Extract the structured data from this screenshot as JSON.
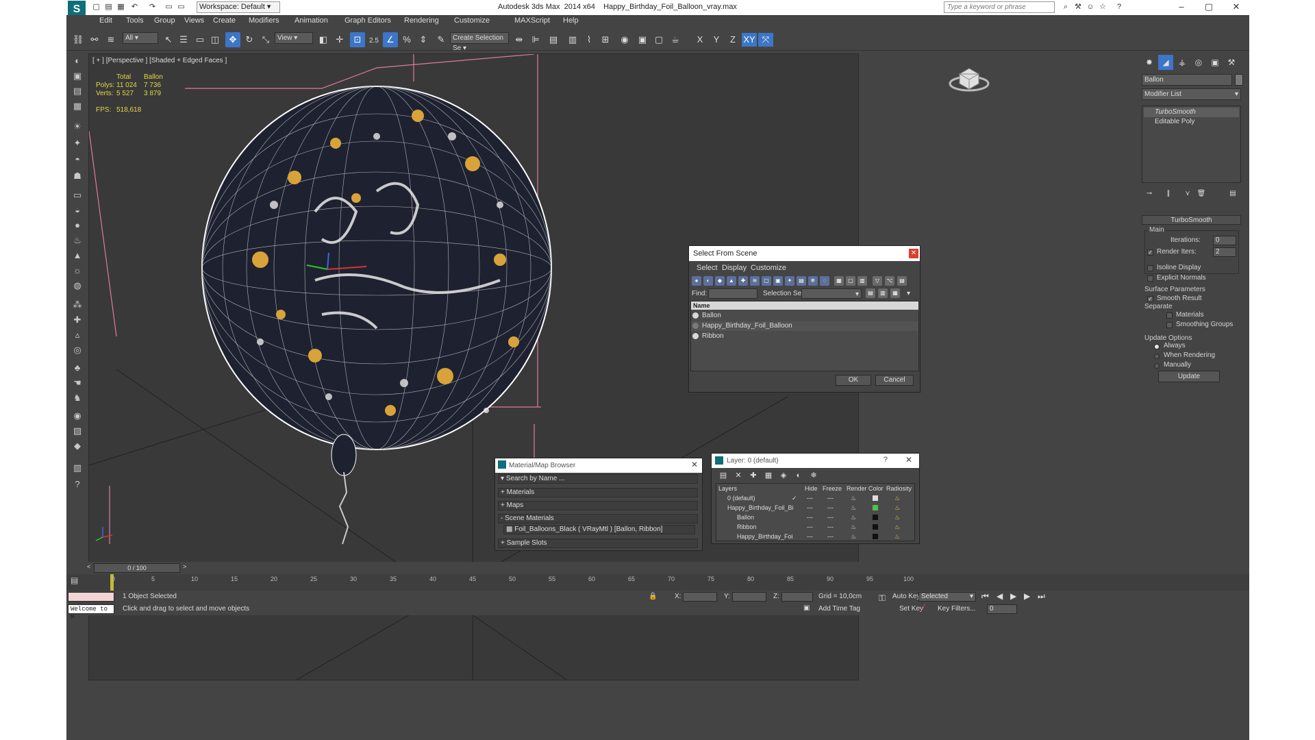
{
  "app": {
    "title": "Autodesk 3ds Max  2014 x64    Happy_Birthday_Foil_Balloon_vray.max",
    "workspace": "Workspace: Default",
    "search_placeholder": "Type a keyword or phrase"
  },
  "menu": [
    "Edit",
    "Tools",
    "Group",
    "Views",
    "Create",
    "Modifiers",
    "Animation",
    "Graph Editors",
    "Rendering",
    "Customize",
    "MAXScript",
    "Help"
  ],
  "toolbar": {
    "selection_filter": "All",
    "coord_system": "View",
    "named_selection_placeholder": "Create Selection Se",
    "snap_label": "2.5",
    "axis_x": "X",
    "axis_y": "Y",
    "axis_z": "Z",
    "axis_xy": "XY"
  },
  "viewport": {
    "label": "[ + ] [Perspective ] [Shaded + Edged Faces ]",
    "stats": {
      "col_total": "Total",
      "col_obj": "Ballon",
      "polys_label": "Polys:",
      "polys_total": "11 024",
      "polys_obj": "7 736",
      "verts_label": "Verts:",
      "verts_total": "5 527",
      "verts_obj": "3 879",
      "fps_label": "FPS:",
      "fps_value": "518,618"
    }
  },
  "command_panel": {
    "object_name": "Ballon",
    "modifier_list": "Modifier List",
    "stack": [
      "TurboSmooth",
      "Editable Poly"
    ],
    "turbosmooth": {
      "header": "TurboSmooth",
      "main": "Main",
      "iterations_label": "Iterations:",
      "iterations": "0",
      "render_iters_label": "Render Iters:",
      "render_iters": "2",
      "isoline": "Isoline Display",
      "explicit": "Explicit Normals",
      "surface_params": "Surface Parameters",
      "smooth_result": "Smooth Result",
      "separate": "Separate",
      "materials": "Materials",
      "smoothing_groups": "Smoothing Groups",
      "update_options": "Update Options",
      "always": "Always",
      "when_rendering": "When Rendering",
      "manually": "Manually",
      "update_btn": "Update"
    }
  },
  "select_dialog": {
    "title": "Select From Scene",
    "menu": [
      "Select",
      "Display",
      "Customize"
    ],
    "find_label": "Find:",
    "selection_set_label": "Selection Set:",
    "column_name": "Name",
    "items": [
      "Ballon",
      "Happy_Birthday_Foil_Balloon",
      "Ribbon"
    ],
    "ok": "OK",
    "cancel": "Cancel"
  },
  "material_browser": {
    "title": "Material/Map Browser",
    "search": "Search by Name ...",
    "materials": "+ Materials",
    "maps": "+ Maps",
    "scene_materials": "- Scene Materials",
    "scene_material_item": "Foil_Balloons_Black ( VRayMtl ) [Ballon, Ribbon]",
    "sample_slots": "+ Sample Slots"
  },
  "layer_dialog": {
    "title": "Layer: 0 (default)",
    "help": "?",
    "headers": [
      "Layers",
      "Hide",
      "Freeze",
      "Render",
      "Color",
      "Radiosity"
    ],
    "rows": [
      "0 (default)",
      "Happy_Birthday_Foil_Bi",
      "Ballon",
      "Ribbon",
      "Happy_Birthday_Foi"
    ]
  },
  "timeline": {
    "frame": "0 / 100",
    "ticks": [
      "0",
      "5",
      "10",
      "15",
      "20",
      "25",
      "30",
      "35",
      "40",
      "45",
      "50",
      "55",
      "60",
      "65",
      "70",
      "75",
      "80",
      "85",
      "90",
      "95",
      "100"
    ]
  },
  "status": {
    "selected": "1 Object Selected",
    "prompt": "Click and drag to select and move objects",
    "welcome": "Welcome to M",
    "x_label": "X:",
    "y_label": "Y:",
    "z_label": "Z:",
    "grid": "Grid = 10,0cm",
    "add_time_tag": "Add Time Tag",
    "auto_key": "Auto Key",
    "selected_combo": "Selected",
    "set_key": "Set Key",
    "key_filters": "Key Filters...",
    "frame_field": "0"
  },
  "colors": {
    "ui_bg": "#444444",
    "viewport_bg": "#393939",
    "accent_blue": "#3b76c8",
    "stats_yellow": "#e6d54a",
    "close_red": "#d8412d"
  }
}
